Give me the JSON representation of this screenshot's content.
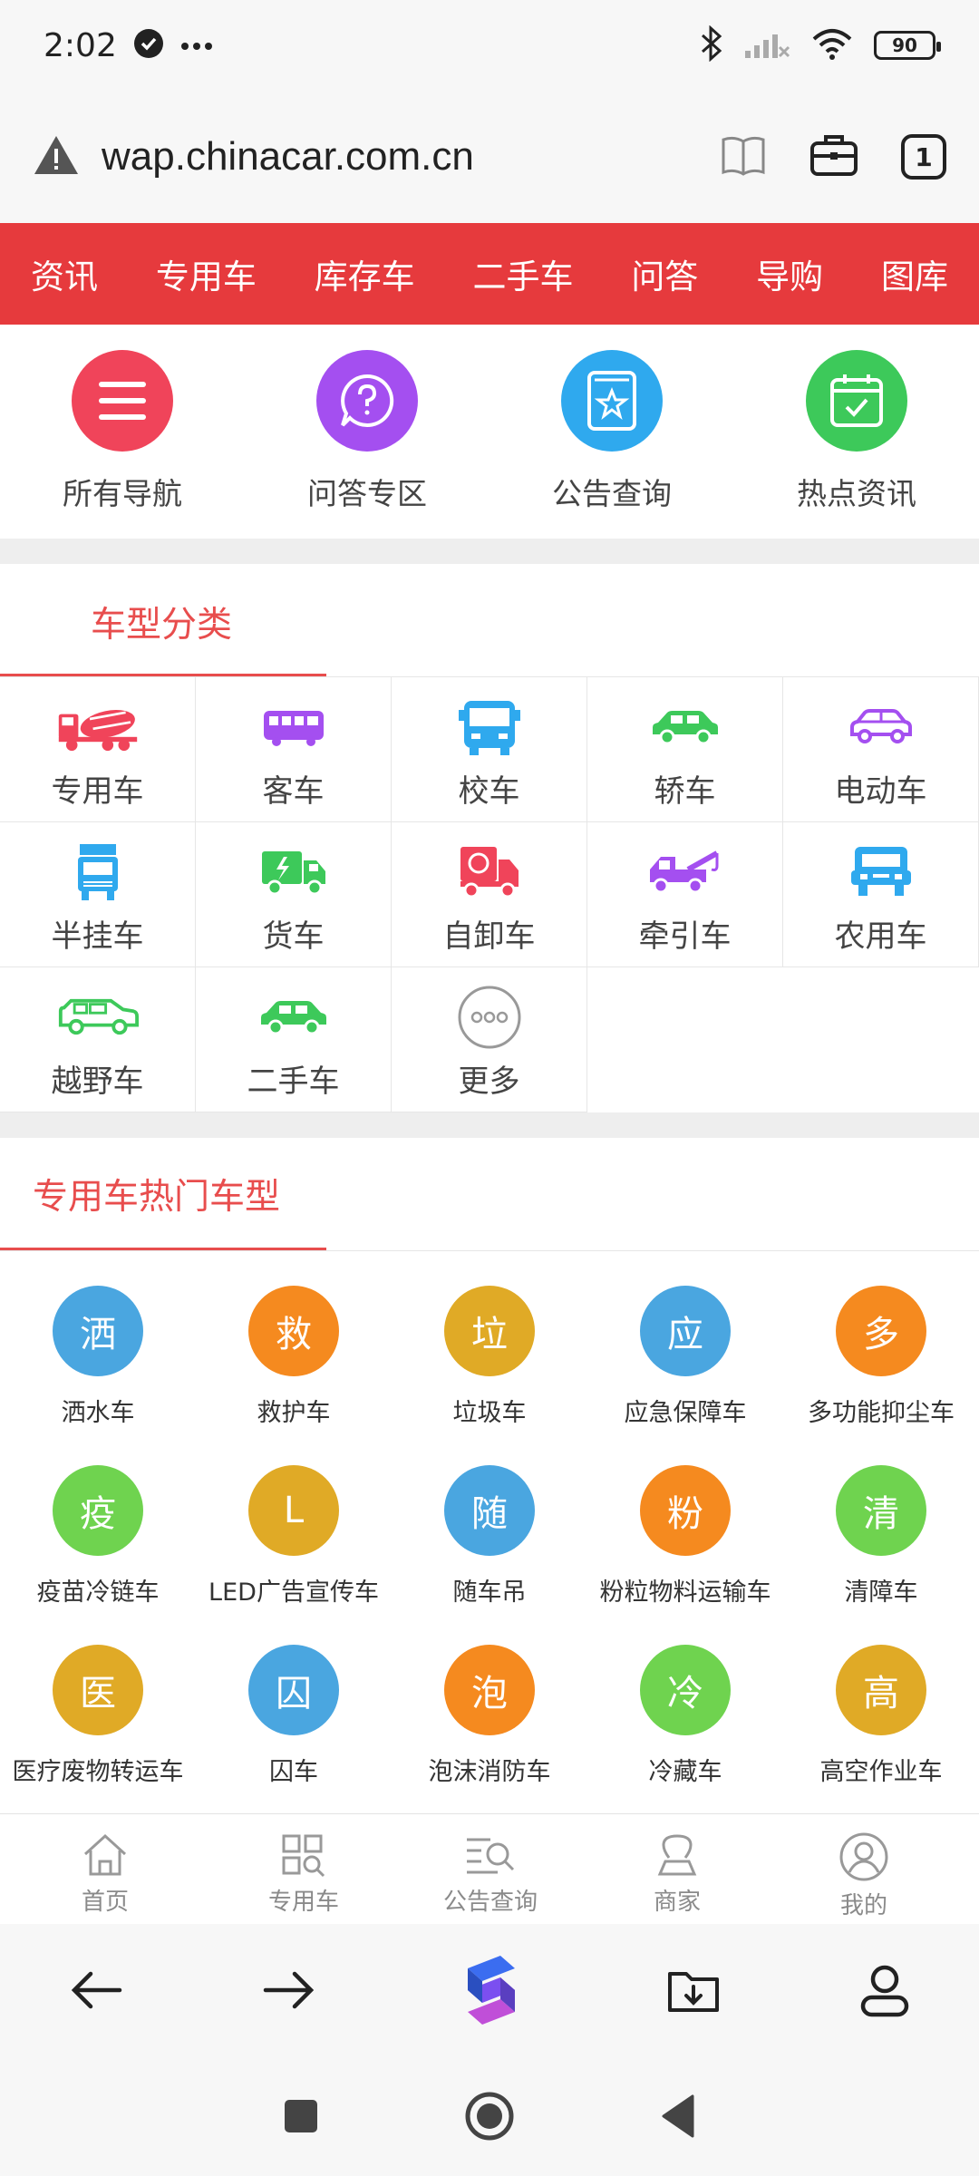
{
  "status": {
    "time": "2:02",
    "battery": "90"
  },
  "url_bar": {
    "url": "wap.chinacar.com.cn",
    "tab_count": "1"
  },
  "red_nav": [
    "资讯",
    "专用车",
    "库存车",
    "二手车",
    "问答",
    "导购",
    "图库"
  ],
  "quick_links": [
    {
      "label": "所有导航",
      "color": "#f0445a",
      "icon": "menu-icon"
    },
    {
      "label": "问答专区",
      "color": "#a44ff0",
      "icon": "question-icon"
    },
    {
      "label": "公告查询",
      "color": "#2fa9ee",
      "icon": "star-book-icon"
    },
    {
      "label": "热点资讯",
      "color": "#3dc95a",
      "icon": "calendar-check-icon"
    }
  ],
  "vehicle_section": {
    "title": "车型分类"
  },
  "vehicle_types": [
    [
      {
        "label": "专用车",
        "icon": "mixer-truck-icon",
        "color": "#f0445a"
      },
      {
        "label": "客车",
        "icon": "bus-icon",
        "color": "#a44ff0"
      },
      {
        "label": "校车",
        "icon": "school-bus-icon",
        "color": "#2fa9ee"
      },
      {
        "label": "轿车",
        "icon": "car-icon",
        "color": "#3dc95a"
      },
      {
        "label": "电动车",
        "icon": "electric-car-icon",
        "color": "#a44ff0"
      }
    ],
    [
      {
        "label": "半挂车",
        "icon": "semi-trailer-icon",
        "color": "#2fa9ee"
      },
      {
        "label": "货车",
        "icon": "cargo-truck-icon",
        "color": "#3dc95a"
      },
      {
        "label": "自卸车",
        "icon": "dump-truck-icon",
        "color": "#f0445a"
      },
      {
        "label": "牵引车",
        "icon": "tow-truck-icon",
        "color": "#a44ff0"
      },
      {
        "label": "农用车",
        "icon": "farm-truck-icon",
        "color": "#2fa9ee"
      }
    ],
    [
      {
        "label": "越野车",
        "icon": "suv-icon",
        "color": "#3dc95a"
      },
      {
        "label": "二手车",
        "icon": "used-car-icon",
        "color": "#3dc95a"
      },
      {
        "label": "更多",
        "icon": "more-icon",
        "color": "#8a8a8a"
      }
    ]
  ],
  "popular_section": {
    "title": "专用车热门车型"
  },
  "popular_types": [
    [
      {
        "char": "洒",
        "label": "洒水车",
        "color": "#4aa6e0"
      },
      {
        "char": "救",
        "label": "救护车",
        "color": "#f58a1f"
      },
      {
        "char": "垃",
        "label": "垃圾车",
        "color": "#e0aa26"
      },
      {
        "char": "应",
        "label": "应急保障车",
        "color": "#4aa6e0"
      },
      {
        "char": "多",
        "label": "多功能抑尘车",
        "color": "#f58a1f"
      }
    ],
    [
      {
        "char": "疫",
        "label": "疫苗冷链车",
        "color": "#6fd34f"
      },
      {
        "char": "L",
        "label": "LED广告宣传车",
        "color": "#e0aa26"
      },
      {
        "char": "随",
        "label": "随车吊",
        "color": "#4aa6e0"
      },
      {
        "char": "粉",
        "label": "粉粒物料运输车",
        "color": "#f58a1f"
      },
      {
        "char": "清",
        "label": "清障车",
        "color": "#6fd34f"
      }
    ],
    [
      {
        "char": "医",
        "label": "医疗废物转运车",
        "color": "#e0aa26"
      },
      {
        "char": "囚",
        "label": "囚车",
        "color": "#4aa6e0"
      },
      {
        "char": "泡",
        "label": "泡沫消防车",
        "color": "#f58a1f"
      },
      {
        "char": "冷",
        "label": "冷藏车",
        "color": "#6fd34f"
      },
      {
        "char": "高",
        "label": "高空作业车",
        "color": "#e0aa26"
      }
    ]
  ],
  "site_tabs": [
    {
      "label": "首页",
      "icon": "home-icon"
    },
    {
      "label": "专用车",
      "icon": "grid-search-icon"
    },
    {
      "label": "公告查询",
      "icon": "list-search-icon"
    },
    {
      "label": "商家",
      "icon": "merchant-icon"
    },
    {
      "label": "我的",
      "icon": "profile-icon"
    }
  ],
  "colors": {
    "brand_red": "#e63a3d",
    "section_red": "#e84d4d"
  }
}
